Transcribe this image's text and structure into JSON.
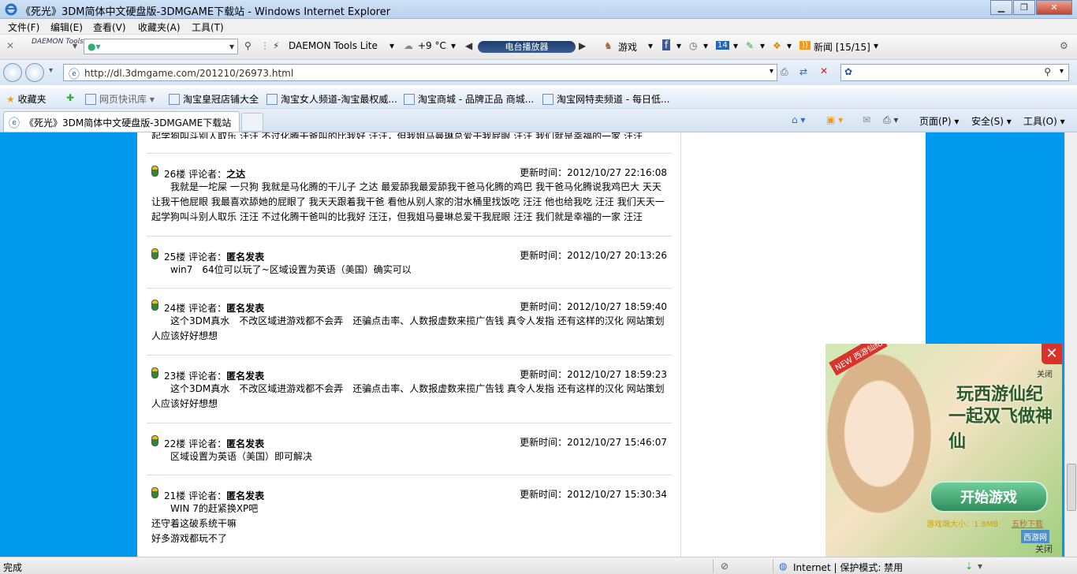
{
  "window": {
    "title": "《死光》3DM简体中文硬盘版-3DMGAME下载站 - Windows Internet Explorer"
  },
  "menubar": [
    "文件(F)",
    "编辑(E)",
    "查看(V)",
    "收藏夹(A)",
    "工具(T)"
  ],
  "toolbar": {
    "daemon_logo": "DAEMON Tools",
    "daemon_label": "DAEMON Tools Lite",
    "weather": "+9 °C",
    "radio": "电台播放器",
    "games": "游戏",
    "news": "新闻 [15/15]"
  },
  "address": {
    "url": "http://dl.3dmgame.com/201210/26973.html"
  },
  "favorites": {
    "label": "收藏夹",
    "items": [
      "网页快讯库",
      "淘宝皇冠店铺大全",
      "淘宝女人频道-淘宝最权威...",
      "淘宝商城 - 品牌正品 商城...",
      "淘宝网特卖频道 - 每日低..."
    ]
  },
  "tab": {
    "title": "《死光》3DM简体中文硬盘版-3DMGAME下载站"
  },
  "commandbar": [
    "页面(P)",
    "安全(S)",
    "工具(O)"
  ],
  "comments": {
    "partial_top": "起学狗叫斗别人取乐 汪汪 不过化腾干爸叫的比我好 汪汪，但我姐马曼琳总爱干我屁眼 汪汪 我们就是幸福的一家 汪汪",
    "items": [
      {
        "floor": "26楼",
        "label": "评论者：",
        "author": "之达",
        "time": "更新时间：2012/10/27 22:16:08",
        "lines": [
          "我就是一坨屎 一只狗 我就是马化腾的干儿子 之达 最爱舔我最爱舔我干爸马化腾的鸡巴 我干爸马化腾说我鸡巴大 天天",
          "让我干他屁眼 我最喜欢舔她的屁眼了 我天天跟着我干爸 看他从别人家的泔水桶里找饭吃 汪汪 他也给我吃 汪汪 我们天天一",
          "起学狗叫斗别人取乐 汪汪 不过化腾干爸叫的比我好 汪汪，但我姐马曼琳总爱干我屁眼 汪汪 我们就是幸福的一家 汪汪"
        ]
      },
      {
        "floor": "25楼",
        "label": "评论者：",
        "author": "匿名发表",
        "time": "更新时间：2012/10/27 20:13:26",
        "lines": [
          "win7　64位可以玩了~区域设置为英语（美国）确实可以"
        ]
      },
      {
        "floor": "24楼",
        "label": "评论者：",
        "author": "匿名发表",
        "time": "更新时间：2012/10/27 18:59:40",
        "lines": [
          "这个3DM真水　不改区域进游戏都不会弄　还骗点击率、人数报虚数来揽广告钱 真令人发指 还有这样的汉化 网站策划",
          "人应该好好想想"
        ]
      },
      {
        "floor": "23楼",
        "label": "评论者：",
        "author": "匿名发表",
        "time": "更新时间：2012/10/27 18:59:23",
        "lines": [
          "这个3DM真水　不改区域进游戏都不会弄　还骗点击率、人数报虚数来揽广告钱 真令人发指 还有这样的汉化 网站策划",
          "人应该好好想想"
        ]
      },
      {
        "floor": "22楼",
        "label": "评论者：",
        "author": "匿名发表",
        "time": "更新时间：2012/10/27 15:46:07",
        "lines": [
          "区域设置为英语（美国）即可解决"
        ]
      },
      {
        "floor": "21楼",
        "label": "评论者：",
        "author": "匿名发表",
        "time": "更新时间：2012/10/27 15:30:34",
        "lines": [
          "WIN 7的赶紧换XP吧",
          "还守着这破系统干嘛",
          "好多游戏都玩不了"
        ]
      }
    ]
  },
  "ad": {
    "badge": "NEW 西游仙纪",
    "close_top": "关闭",
    "slogan1": "玩西游仙纪",
    "slogan2": "一起双飞做神仙",
    "play": "开始游戏",
    "size": "游戏端大小：1.8MB",
    "download": "五秒下载",
    "brand": "西游网",
    "close_bottom": "关闭"
  },
  "status": {
    "left": "完成",
    "zone": "Internet | 保护模式: 禁用"
  },
  "colors": {
    "page_bg": "#0099ee",
    "titlebar": "#cfe1f5"
  }
}
